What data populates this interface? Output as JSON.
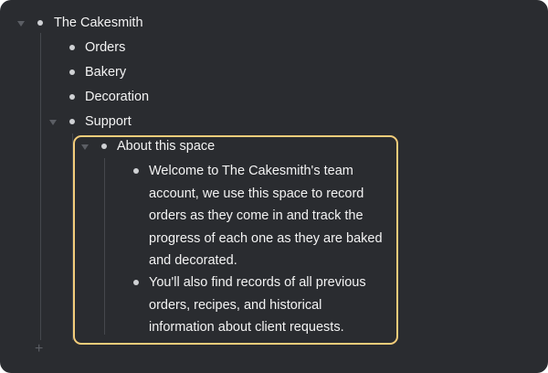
{
  "tree": {
    "root_label": "The Cakesmith",
    "children": [
      {
        "label": "Orders"
      },
      {
        "label": "Bakery"
      },
      {
        "label": "Decoration"
      },
      {
        "label": "Support"
      }
    ],
    "support_child": {
      "label": "About this space",
      "paragraphs": [
        {
          "lines": [
            "Welcome to The Cakesmith's team",
            "account, we use this space to record",
            "orders as they come in and track the",
            "progress of each one as they are baked",
            "and decorated."
          ]
        },
        {
          "lines": [
            "You'll also find records of all previous",
            "orders, recipes, and historical",
            "information about client requests."
          ]
        }
      ]
    }
  },
  "add_button": {
    "label": "+"
  },
  "colors": {
    "background": "#2a2c30",
    "highlight_border": "#f3cd7a",
    "text": "#f3f3f3",
    "muted": "#5b5e64"
  }
}
